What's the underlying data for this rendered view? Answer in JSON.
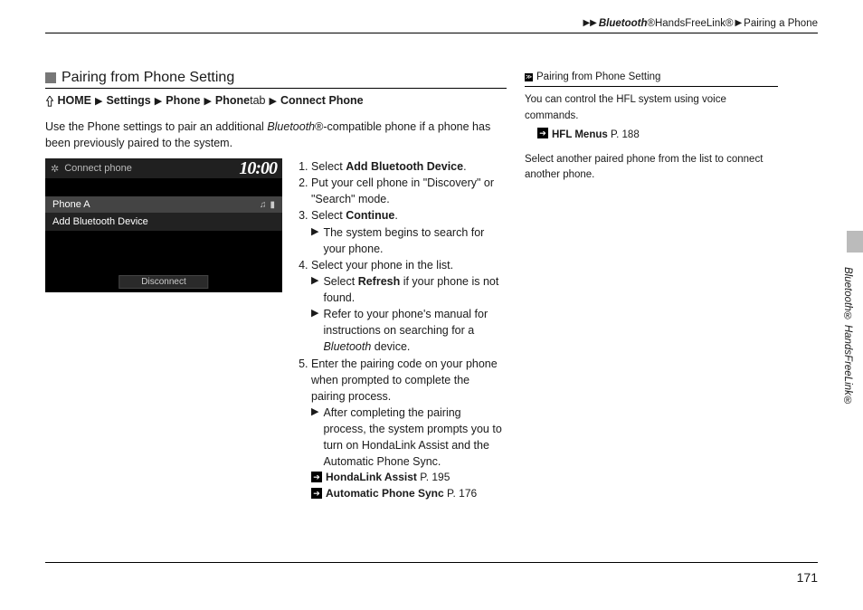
{
  "header": {
    "path1": "Bluetooth",
    "path1_reg": "®",
    "path2": " HandsFreeLink®",
    "path3": "Pairing a Phone"
  },
  "section_title": "Pairing from Phone Setting",
  "breadcrumb": {
    "home": "HOME",
    "settings": "Settings",
    "phone": "Phone",
    "phone_tab": "Phone",
    "tab_word": " tab ",
    "connect": "Connect Phone"
  },
  "intro": {
    "pre": "Use the Phone settings to pair an additional ",
    "bluetooth": "Bluetooth",
    "reg": "®",
    "post": "-compatible phone if a phone has been previously paired to the system."
  },
  "phone_ui": {
    "title": "Connect phone",
    "clock": "10:00",
    "row1": "Phone A",
    "row2": "Add Bluetooth Device",
    "disconnect": "Disconnect"
  },
  "steps": {
    "s1a": "Select ",
    "s1b": "Add Bluetooth Device",
    "s1c": ".",
    "s2": "Put your cell phone in \"Discovery\" or \"Search\" mode.",
    "s3a": "Select ",
    "s3b": "Continue",
    "s3c": ".",
    "s3_sub1": "The system begins to search for your phone.",
    "s4": "Select your phone in the list.",
    "s4_sub1a": "Select ",
    "s4_sub1b": "Refresh",
    "s4_sub1c": " if your phone is not found.",
    "s4_sub2a": "Refer to your phone's manual for instructions on searching for a ",
    "s4_sub2b": "Bluetooth",
    "s4_sub2c": " device.",
    "s5": "Enter the pairing code on your phone when prompted to complete the pairing process.",
    "s5_sub1": "After completing the pairing process, the system prompts you to turn on HondaLink Assist and the Automatic Phone Sync.",
    "xref1a": "HondaLink Assist",
    "xref1b": " P. 195",
    "xref2a": "Automatic Phone Sync",
    "xref2b": " P. 176"
  },
  "sidebar": {
    "title": "Pairing from Phone Setting",
    "line1": "You can control the HFL system using voice commands.",
    "xref1a": "HFL Menus",
    "xref1b": " P. 188",
    "line2": "Select another paired phone from the list to connect another phone."
  },
  "side_tab": {
    "bluetooth": "Bluetooth",
    "reg": "® ",
    "hfl": "HandsFreeLink®"
  },
  "page_number": "171"
}
